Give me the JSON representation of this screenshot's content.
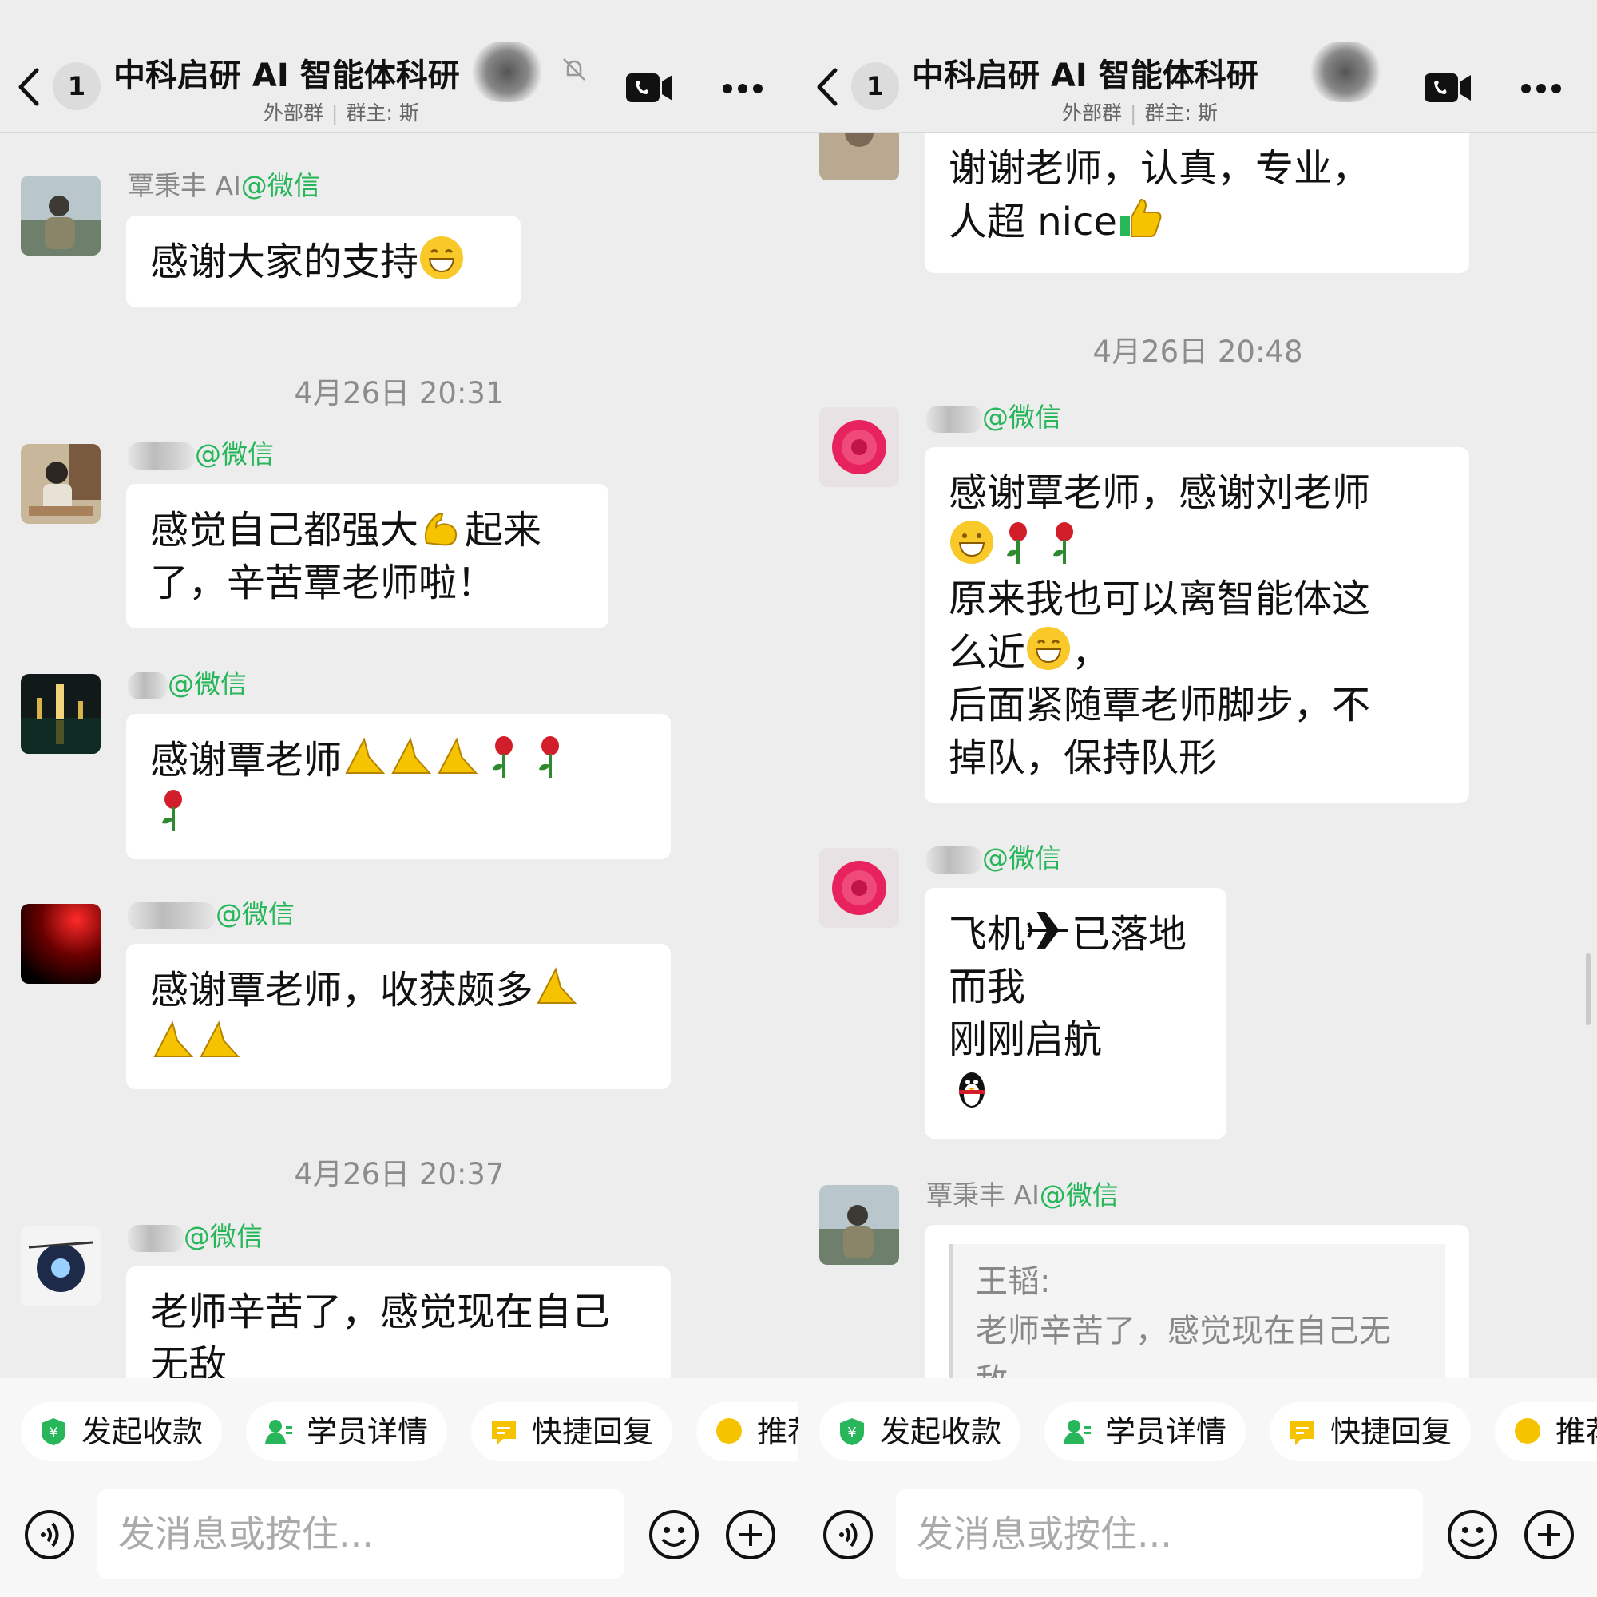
{
  "left": {
    "header": {
      "badge": "1",
      "title": "中科启研 AI 智能体科研",
      "subtitle_type": "外部群",
      "subtitle_owner": "群主: 斯"
    },
    "timestamps": [
      "4月26日 20:31",
      "4月26日 20:37"
    ],
    "messages": [
      {
        "sender": "覃秉丰 AI",
        "suffix": "@微信",
        "text": "感谢大家的支持"
      },
      {
        "sender": "",
        "suffix": "@微信",
        "text1": "感觉自己都强大",
        "text2": "起来",
        "text3": "了，辛苦覃老师啦！"
      },
      {
        "sender": "",
        "suffix": "@微信",
        "text": "感谢覃老师"
      },
      {
        "sender": "",
        "suffix": "@微信",
        "text": "感谢覃老师，收获颇多"
      },
      {
        "sender": "",
        "suffix": "@微信",
        "text": "老师辛苦了，感觉现在自己无敌"
      }
    ]
  },
  "right": {
    "header": {
      "badge": "1",
      "title": "中科启研 AI 智能体科研",
      "subtitle_type": "外部群",
      "subtitle_owner": "群主: 斯"
    },
    "timestamps": [
      "4月26日 20:48"
    ],
    "messages": [
      {
        "text1": "谢谢老师，认真，专业，",
        "text2": "人超 nice"
      },
      {
        "sender": "",
        "suffix": "@微信",
        "line1": "感谢覃老师，感谢刘老师",
        "line3": "原来我也可以离智能体这",
        "line4": "么近",
        "line4b": "，",
        "line5": "后面紧随覃老师脚步，不",
        "line6": "掉队，保持队形"
      },
      {
        "sender": "",
        "suffix": "@微信",
        "line1a": "飞机",
        "line1b": "已落地",
        "line2": "而我",
        "line3": "刚刚启航"
      },
      {
        "sender": "覃秉丰 AI",
        "suffix": "@微信",
        "quote_name": "王韬:",
        "quote_text": "老师辛苦了，感觉现在自己无敌"
      }
    ]
  },
  "actions": [
    "发起收款",
    "学员详情",
    "快捷回复",
    "推荐"
  ],
  "input": {
    "placeholder": "发消息或按住..."
  },
  "icons": {
    "back": "back-icon",
    "video": "video-call-icon",
    "more": "more-icon",
    "mute": "mute-bell-icon",
    "voice": "voice-icon",
    "emoji": "smile-icon",
    "plus": "plus-icon",
    "payment": "payment-icon",
    "student": "student-icon",
    "quick": "quick-reply-icon",
    "recommend": "recommend-icon"
  },
  "colors": {
    "wechat_green": "#27b65a",
    "accent_yellow": "#f5c300",
    "background": "#ededed"
  }
}
